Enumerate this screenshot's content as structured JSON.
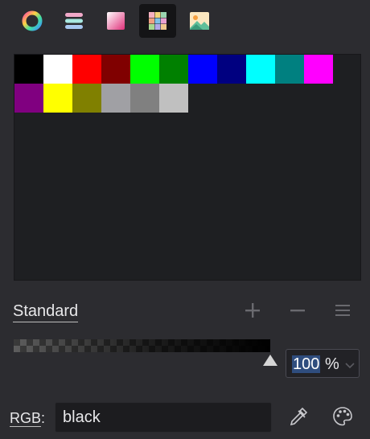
{
  "toolbar": {
    "tabs": [
      {
        "name": "color-wheel-icon",
        "active": false
      },
      {
        "name": "color-sliders-icon",
        "active": false
      },
      {
        "name": "color-gradient-icon",
        "active": false
      },
      {
        "name": "color-palettes-icon",
        "active": true
      },
      {
        "name": "image-colors-icon",
        "active": false
      }
    ]
  },
  "palette": {
    "swatches": [
      "#000000",
      "#ffffff",
      "#ff0000",
      "#800000",
      "#00ff00",
      "#008000",
      "#0000ff",
      "#000080",
      "#00ffff",
      "#008080",
      "#ff00ff",
      "#800080",
      "#ffff00",
      "#808000",
      "#a0a0a4",
      "#808080",
      "#c0c0c0"
    ]
  },
  "palette_name": "Standard",
  "actions": {
    "add_icon": "plus-icon",
    "remove_icon": "minus-icon",
    "menu_icon": "hamburger-menu-icon"
  },
  "opacity": {
    "value": "100",
    "unit": "%"
  },
  "color_model": {
    "label": "RGB",
    "separator": ":"
  },
  "color_name": "black",
  "tools": {
    "picker_icon": "eyedropper-icon",
    "palette_icon": "paint-palette-icon"
  }
}
